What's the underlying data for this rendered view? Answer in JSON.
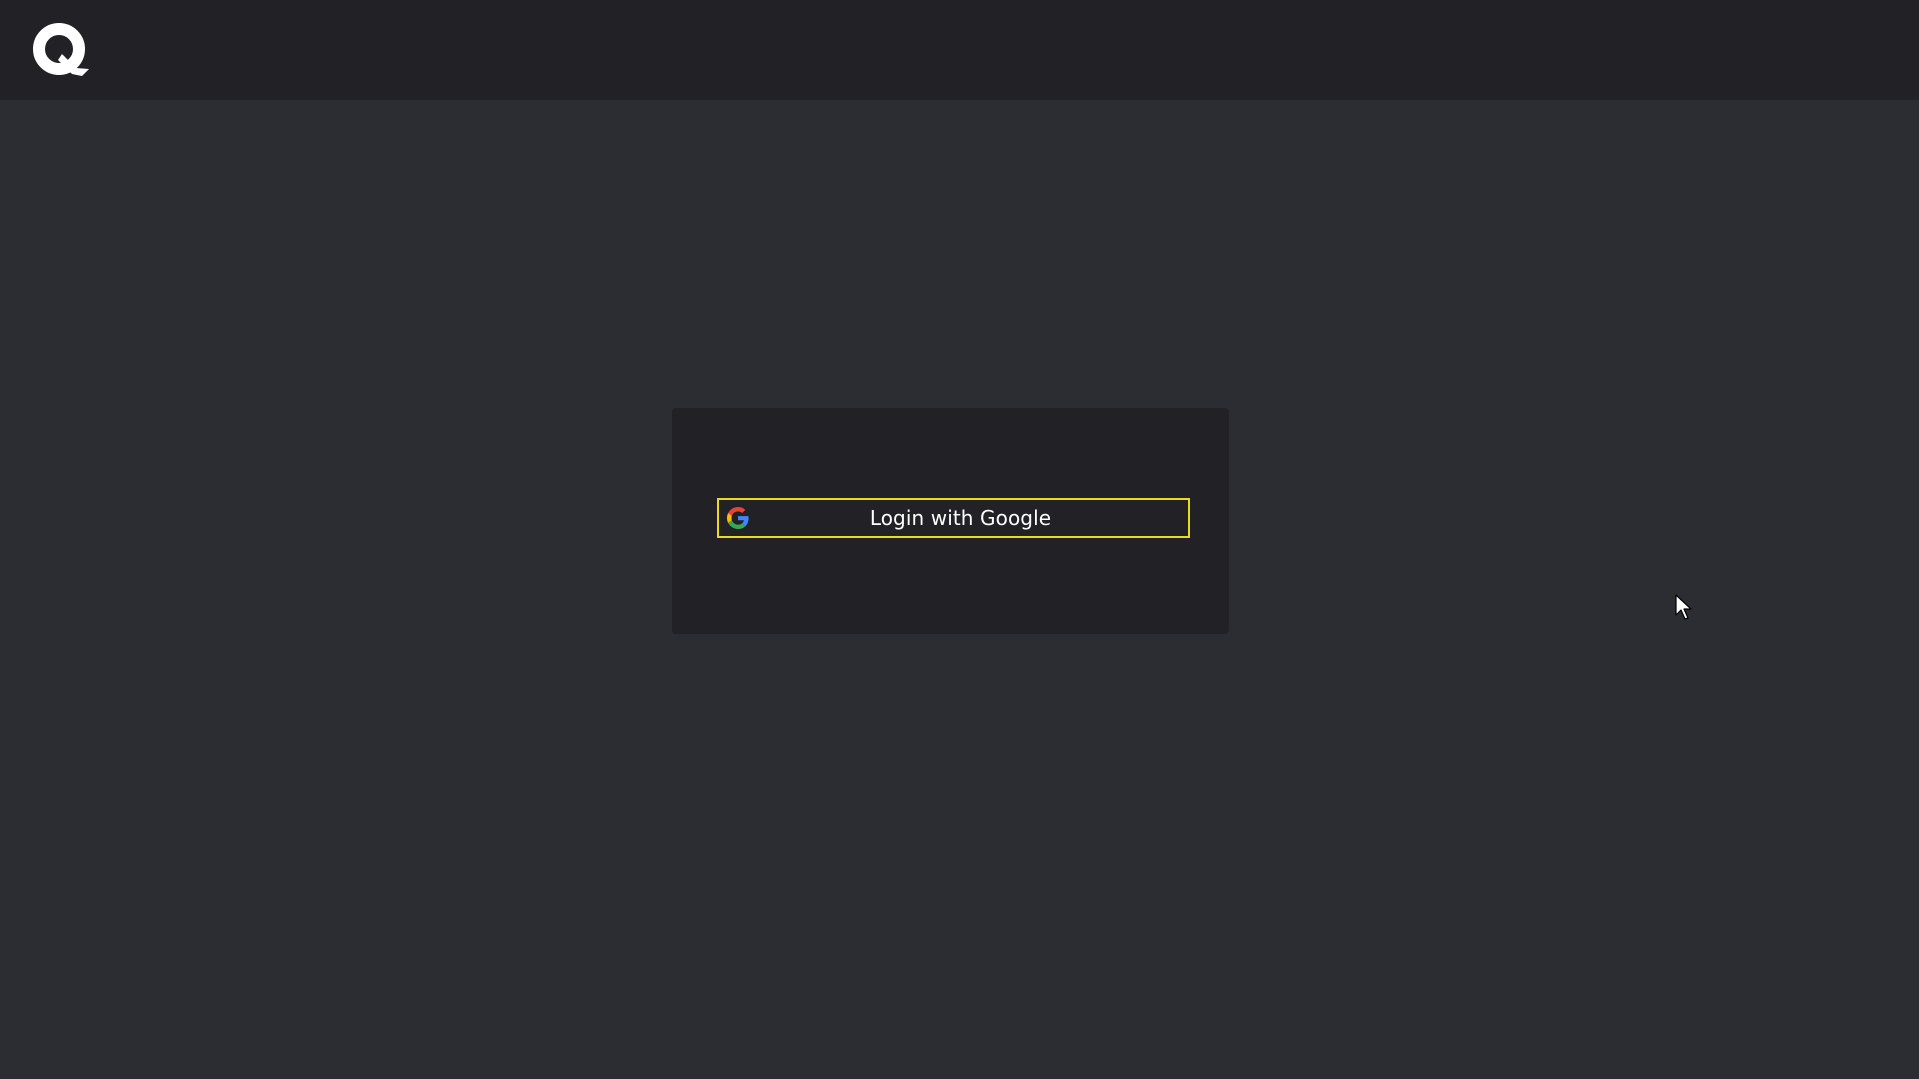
{
  "app": {
    "logo_icon": "q-logo-icon"
  },
  "login": {
    "google_button_label": "Login with Google",
    "google_icon": "google-g-icon",
    "accent_border_color": "#e8dd1b"
  },
  "colors": {
    "topbar_bg": "#222226",
    "page_bg": "#2b2d33",
    "card_bg": "#222226",
    "text": "#ffffff"
  }
}
